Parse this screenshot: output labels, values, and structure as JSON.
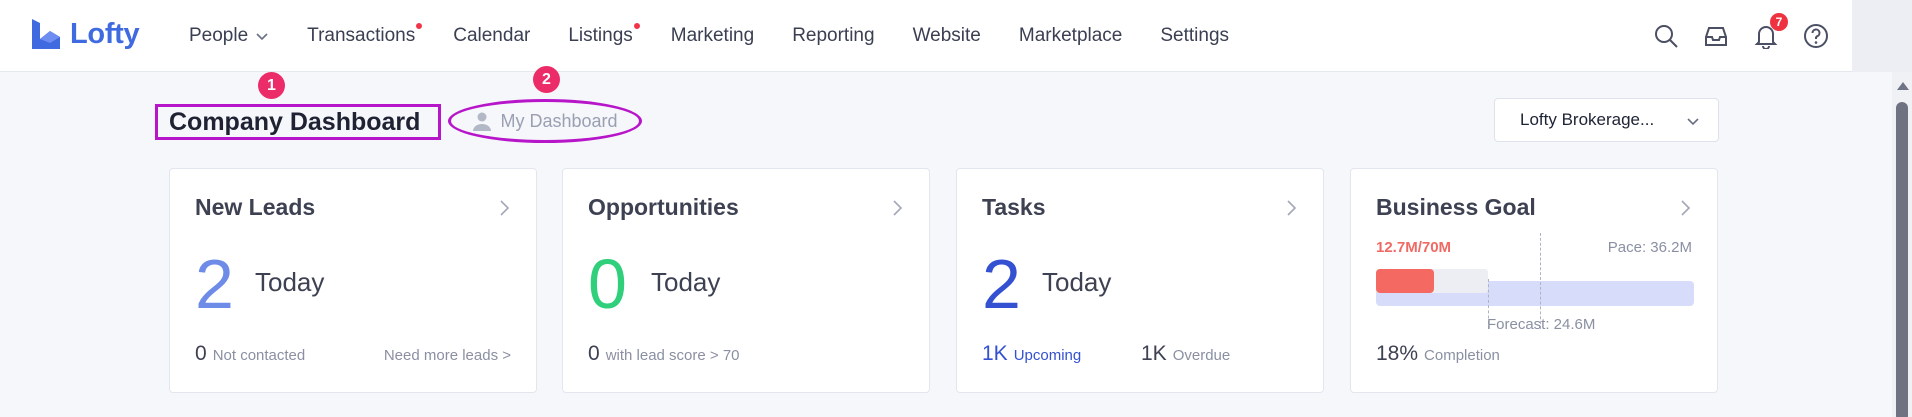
{
  "brand": {
    "name": "Lofty",
    "color": "#3f6ae0"
  },
  "nav": {
    "items": [
      {
        "label": "People",
        "dot": false,
        "dropdown": true
      },
      {
        "label": "Transactions",
        "dot": true,
        "dropdown": false
      },
      {
        "label": "Calendar",
        "dot": false,
        "dropdown": false
      },
      {
        "label": "Listings",
        "dot": true,
        "dropdown": false
      },
      {
        "label": "Marketing",
        "dot": false,
        "dropdown": false
      },
      {
        "label": "Reporting",
        "dot": false,
        "dropdown": false
      },
      {
        "label": "Website",
        "dot": false,
        "dropdown": false
      },
      {
        "label": "Marketplace",
        "dot": false,
        "dropdown": false
      },
      {
        "label": "Settings",
        "dot": false,
        "dropdown": false
      }
    ]
  },
  "toolbar": {
    "icons": [
      "search-icon",
      "inbox-icon",
      "bell-icon",
      "help-icon"
    ],
    "notification_count": "7"
  },
  "header": {
    "title": "Company Dashboard",
    "my_dashboard_tab": "My Dashboard",
    "marker_1": "1",
    "marker_2": "2",
    "annotation_color": "#b715c9",
    "org_select": "Lofty Brokerage..."
  },
  "cards": {
    "new_leads": {
      "title": "New Leads",
      "big": "2",
      "big_color": "#6e8be8",
      "today": "Today",
      "foot_num": "0",
      "foot_text": "Not contacted",
      "link": "Need more leads >"
    },
    "opportunities": {
      "title": "Opportunities",
      "big": "0",
      "big_color": "#2fcf7b",
      "today": "Today",
      "foot_num": "0",
      "foot_text": "with lead score > 70"
    },
    "tasks": {
      "title": "Tasks",
      "big": "2",
      "big_color": "#3451d1",
      "today": "Today",
      "upcoming_num": "1K",
      "upcoming_text": "Upcoming",
      "overdue_num": "1K",
      "overdue_text": "Overdue"
    },
    "business_goal": {
      "title": "Business Goal",
      "progress": "12.7M/70M",
      "pace": "Pace: 36.2M",
      "forecast": "Forecast: 24.6M",
      "completion_pct": "18%",
      "completion_text": "Completion",
      "progress_fraction": 0.181,
      "forecast_fraction": 0.351,
      "pace_fraction": 0.517
    }
  }
}
